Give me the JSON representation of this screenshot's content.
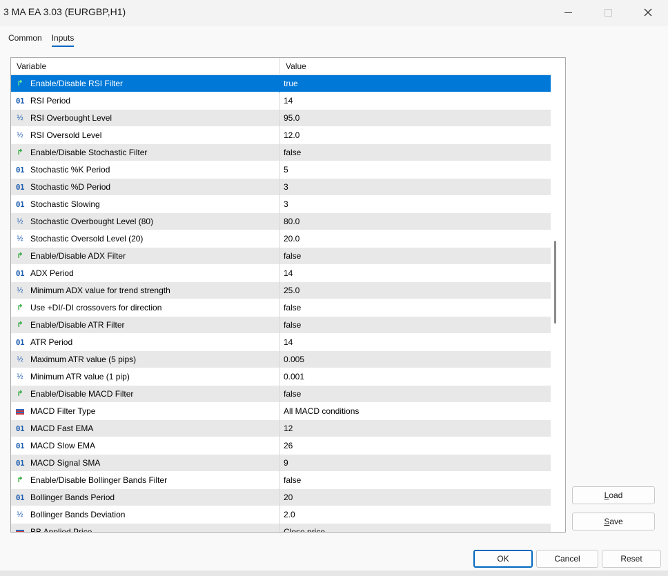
{
  "window": {
    "title": "3 MA EA 3.03 (EURGBP,H1)"
  },
  "tabs": [
    {
      "label": "Common",
      "active": false
    },
    {
      "label": "Inputs",
      "active": true
    }
  ],
  "grid": {
    "columns": {
      "variable": "Variable",
      "value": "Value"
    },
    "rows": [
      {
        "icon": "bool-icon",
        "variable": "Enable/Disable RSI Filter",
        "value": "true",
        "selected": true
      },
      {
        "icon": "int-icon",
        "variable": "RSI Period",
        "value": "14"
      },
      {
        "icon": "double-icon",
        "variable": "RSI Overbought Level",
        "value": "95.0"
      },
      {
        "icon": "double-icon",
        "variable": "RSI Oversold Level",
        "value": "12.0"
      },
      {
        "icon": "bool-icon",
        "variable": "Enable/Disable Stochastic Filter",
        "value": "false"
      },
      {
        "icon": "int-icon",
        "variable": "Stochastic %K Period",
        "value": "5"
      },
      {
        "icon": "int-icon",
        "variable": "Stochastic %D Period",
        "value": "3"
      },
      {
        "icon": "int-icon",
        "variable": "Stochastic Slowing",
        "value": "3"
      },
      {
        "icon": "double-icon",
        "variable": "Stochastic Overbought Level (80)",
        "value": "80.0"
      },
      {
        "icon": "double-icon",
        "variable": "Stochastic Oversold Level (20)",
        "value": "20.0"
      },
      {
        "icon": "bool-icon",
        "variable": "Enable/Disable ADX Filter",
        "value": "false"
      },
      {
        "icon": "int-icon",
        "variable": "ADX Period",
        "value": "14"
      },
      {
        "icon": "double-icon",
        "variable": "Minimum ADX value for trend strength",
        "value": "25.0"
      },
      {
        "icon": "bool-icon",
        "variable": "Use +DI/-DI crossovers for direction",
        "value": "false"
      },
      {
        "icon": "bool-icon",
        "variable": "Enable/Disable ATR Filter",
        "value": "false"
      },
      {
        "icon": "int-icon",
        "variable": "ATR Period",
        "value": "14"
      },
      {
        "icon": "double-icon",
        "variable": "Maximum ATR value (5 pips)",
        "value": "0.005"
      },
      {
        "icon": "double-icon",
        "variable": "Minimum ATR value (1 pip)",
        "value": "0.001"
      },
      {
        "icon": "bool-icon",
        "variable": "Enable/Disable MACD Filter",
        "value": "false"
      },
      {
        "icon": "enum-icon",
        "variable": "MACD Filter Type",
        "value": "All MACD conditions"
      },
      {
        "icon": "int-icon",
        "variable": "MACD Fast EMA",
        "value": "12"
      },
      {
        "icon": "int-icon",
        "variable": "MACD Slow EMA",
        "value": "26"
      },
      {
        "icon": "int-icon",
        "variable": "MACD Signal SMA",
        "value": "9"
      },
      {
        "icon": "bool-icon",
        "variable": "Enable/Disable Bollinger Bands Filter",
        "value": "false"
      },
      {
        "icon": "int-icon",
        "variable": "Bollinger Bands Period",
        "value": "20"
      },
      {
        "icon": "double-icon",
        "variable": "Bollinger Bands Deviation",
        "value": "2.0"
      },
      {
        "icon": "enum-icon",
        "variable": "BB Applied Price",
        "value": "Close price"
      }
    ]
  },
  "buttons": {
    "load": {
      "underline": "L",
      "rest": "oad"
    },
    "save": {
      "underline": "S",
      "rest": "ave"
    },
    "ok": "OK",
    "cancel": "Cancel",
    "reset": "Reset"
  },
  "icon_glyphs": {
    "int-icon": "01",
    "double-icon": "½",
    "bool-icon": "↱"
  },
  "colors": {
    "accent": "#0078d7",
    "row_alt": "#e8e8e8"
  }
}
